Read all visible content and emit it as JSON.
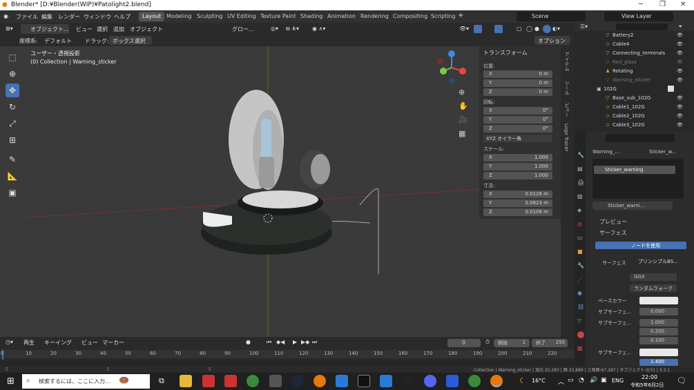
{
  "window": {
    "title": "Blender* [D:¥Blender(WIP)¥Patolight2.blend]"
  },
  "menu": {
    "file": "ファイル",
    "edit": "編集",
    "render": "レンダー",
    "window": "ウィンドウ",
    "help": "ヘルプ"
  },
  "workspaces": [
    "Layout",
    "Modeling",
    "Sculpting",
    "UV Editing",
    "Texture Paint",
    "Shading",
    "Animation",
    "Rendering",
    "Compositing",
    "Scripting"
  ],
  "scene": "Scene",
  "view_layer": "View Layer",
  "vp_header": {
    "mode": "オブジェクト...",
    "view": "ビュー",
    "select": "選択",
    "add": "追加",
    "object": "オブジェクト",
    "orientation": "グロー...",
    "options": "オプション"
  },
  "vp_header2": {
    "coord_label": "座標系:",
    "coord_value": "デフォルト",
    "drag_label": "ドラッグ:",
    "drag_value": "ボックス選択"
  },
  "overlay": {
    "view_name": "ユーザー・透視投影",
    "collection": "(0) Collection | Warning_sticker"
  },
  "npanel": {
    "title": "トランスフォーム",
    "location": "位置:",
    "rotation": "回転:",
    "rot_mode": "XYZ オイラー角",
    "scale": "スケール:",
    "dimensions": "寸法:",
    "loc": [
      {
        "k": "X",
        "v": "0 m"
      },
      {
        "k": "Y",
        "v": "0 m"
      },
      {
        "k": "Z",
        "v": "0 m"
      }
    ],
    "rot": [
      {
        "k": "X",
        "v": "0°"
      },
      {
        "k": "Y",
        "v": "0°"
      },
      {
        "k": "Z",
        "v": "0°"
      }
    ],
    "scl": [
      {
        "k": "X",
        "v": "1.000"
      },
      {
        "k": "Y",
        "v": "1.000"
      },
      {
        "k": "Z",
        "v": "1.000"
      }
    ],
    "dim": [
      {
        "k": "X",
        "v": "0.0126 m"
      },
      {
        "k": "Y",
        "v": "0.0823 m"
      },
      {
        "k": "Z",
        "v": "0.0108 m"
      }
    ]
  },
  "side_tabs": [
    "アイテム",
    "ツール",
    "ビュー",
    "Logo Tracer"
  ],
  "outliner": [
    "Battery2",
    "Cable4",
    "Connecting_terminals",
    "Red_glass",
    "Rotating",
    "Warning_sticker",
    "102G",
    "Base_sub_102G",
    "Cable1_102G",
    "Cable2_102G",
    "Cable3_102G"
  ],
  "props": {
    "breadcrumb_obj": "Warning_...",
    "breadcrumb_mat": "Sticker_w...",
    "slot": "Sticker_warning",
    "mat_name": "Sticker_warni...",
    "preview": "プレビュー",
    "surface": "サーフェス",
    "use_nodes": "ノードを使用",
    "surface_label": "サーフェス",
    "surface_value": "プリンシプルBS...",
    "dist": "GGX",
    "sss": "ランダムウォーク",
    "base_color": "ベースカラー",
    "subsurf": "サブサーフェ...",
    "subsurf_val": "0.000",
    "subsurf_r": "サブサーフェ...",
    "r1": "1.000",
    "r2": "0.200",
    "r3": "0.100",
    "subsurf_c": "サブサーフェ...",
    "last": "1.400"
  },
  "timeline": {
    "play": "再生",
    "keying": "キーイング",
    "view": "ビュー",
    "marker": "マーカー",
    "frame": "0",
    "start_label": "開始",
    "start": "1",
    "end_label": "終了",
    "end": "250",
    "ticks": [
      "0",
      "10",
      "20",
      "30",
      "40",
      "50",
      "60",
      "70",
      "80",
      "90",
      "100",
      "110",
      "120",
      "130",
      "140",
      "150",
      "160",
      "170",
      "180",
      "190",
      "200",
      "210",
      "220"
    ]
  },
  "status": "Collection | Warning_sticker | 頂点:35,283 | 面:32,889 | 三角面:67,287 | オブジェクト:0/31 | 3.3.1",
  "taskbar": {
    "search": "検索するには、ここに入力...",
    "temp": "16°C",
    "lang": "ENG",
    "time": "22:00",
    "date": "令和5年6月2日"
  }
}
